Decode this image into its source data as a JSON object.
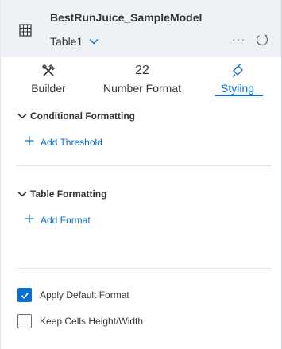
{
  "header": {
    "model_name": "BestRunJuice_SampleModel",
    "table_name": "Table1",
    "more_label": "···"
  },
  "tabs": [
    {
      "label": "Builder",
      "icon": "tools-icon",
      "active": false
    },
    {
      "label": "Number Format",
      "icon_text": "22",
      "active": false
    },
    {
      "label": "Styling",
      "icon": "paint-bucket-icon",
      "active": true
    }
  ],
  "conditional_formatting": {
    "title": "Conditional Formatting",
    "add_label": "Add Threshold"
  },
  "table_formatting": {
    "title": "Table Formatting",
    "add_label": "Add Format"
  },
  "options": [
    {
      "label": "Apply Default Format",
      "checked": true
    },
    {
      "label": "Keep Cells Height/Width",
      "checked": false
    }
  ],
  "colors": {
    "accent": "#0a6ed1",
    "header_bg": "#eef2f6",
    "text": "#32363a"
  }
}
